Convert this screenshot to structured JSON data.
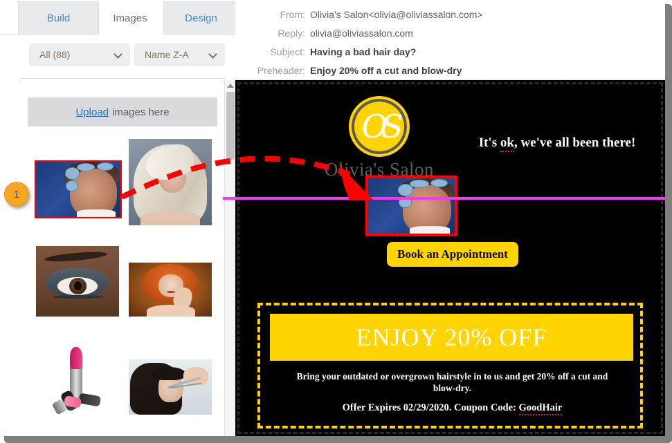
{
  "app": {
    "panel_tabs": [
      {
        "label": "Build",
        "state": "inactive"
      },
      {
        "label": "Images",
        "state": "active"
      },
      {
        "label": "Design",
        "state": "inactive"
      }
    ]
  },
  "images_panel": {
    "filter_select": {
      "value": "All (88)",
      "icon": "chevron-down-icon"
    },
    "sort_select": {
      "value": "Name Z-A",
      "icon": "chevron-down-icon"
    },
    "upload": {
      "link_text": "Upload",
      "rest_text": "images here"
    },
    "thumbnails": [
      {
        "name": "woman-with-hair-rollers",
        "selected": true,
        "alt": "Woman with blue hair rollers making a face"
      },
      {
        "name": "platinum-blonde-woman",
        "selected": false,
        "alt": "Platinum blonde woman with long layered hair"
      },
      {
        "name": "smoky-eye-makeup",
        "selected": false,
        "alt": "Close up of smoky eye makeup"
      },
      {
        "name": "redhead-curly-hair",
        "selected": false,
        "alt": "Redhead woman with curly bob"
      },
      {
        "name": "lipsticks",
        "selected": false,
        "alt": "Three lipsticks on white background"
      },
      {
        "name": "haircut-scissors",
        "selected": false,
        "alt": "Stylist cutting bangs with scissors"
      }
    ],
    "scrollbar": {
      "up_arrow": "scroll-up-icon"
    }
  },
  "email_header": {
    "rows": [
      {
        "label": "From:",
        "value": "Olivia's Salon<olivia@oliviassalon.com>",
        "bold": false
      },
      {
        "label": "Reply:",
        "value": "olivia@oliviassalon.com",
        "bold": false
      },
      {
        "label": "Subject:",
        "value": "Having a bad hair day?",
        "bold": true
      },
      {
        "label": "Preheader:",
        "value": "Enjoy 20% off a cut and blow-dry",
        "bold": true
      }
    ]
  },
  "email_body": {
    "background_color": "#000000",
    "logo": {
      "monogram": "OS",
      "brand_name": "Olivia's Salon",
      "circle_color": "#ffd400"
    },
    "tagline": {
      "prefix": "It's ",
      "misspelled": "ok",
      "suffix": ", we've all been there!"
    },
    "dropped_image": {
      "name": "woman-with-hair-rollers",
      "alt": "Woman with blue hair rollers making a face"
    },
    "cta_button": {
      "label": "Book an Appointment",
      "bg_color": "#ffd400",
      "text_color": "#111111"
    },
    "coupon": {
      "headline": "ENJOY 20% OFF",
      "body": "Bring your outdated or overgrown hairstyle in to us and get 20% off a cut and blow-dry.",
      "expiry_prefix": "Offer Expires 02/29/2020. Coupon Code: ",
      "coupon_code": "GoodHair",
      "border_color": "#ffd400"
    },
    "drop_indicator_color": "#ff2fff"
  },
  "annotations": {
    "step_badge": {
      "number": "1",
      "color": "#f5a623"
    },
    "arrow": {
      "name": "drag-arrow",
      "color": "#ff0000",
      "style": "dashed-curved"
    },
    "selection_outline_color": "#ff0000"
  }
}
